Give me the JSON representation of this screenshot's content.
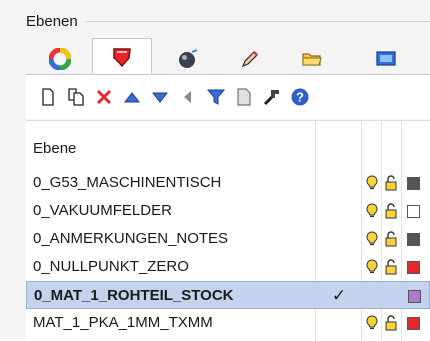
{
  "panel": {
    "title": "Ebenen"
  },
  "tabs": [
    {
      "icon": "color-wheel-icon",
      "active": false
    },
    {
      "icon": "layer-shield-icon",
      "active": true
    },
    {
      "icon": "material-sphere-icon",
      "active": false
    },
    {
      "icon": "pencil-icon",
      "active": false
    },
    {
      "icon": "folder-icon",
      "active": false
    },
    {
      "icon": "display-icon",
      "active": false
    }
  ],
  "toolbar": [
    "new-layer-icon",
    "copy-layer-icon",
    "delete-icon",
    "move-up-icon",
    "move-down-icon",
    "back-icon",
    "filter-icon",
    "properties-icon",
    "tools-icon",
    "help-icon"
  ],
  "list": {
    "header": "Ebene",
    "rows": [
      {
        "name": "0_G53_MASCHINENTISCH",
        "swatch": "#555555",
        "current": false,
        "selected": false
      },
      {
        "name": "0_VAKUUMFELDER",
        "swatch": "#ffffff",
        "current": false,
        "selected": false
      },
      {
        "name": "0_ANMERKUNGEN_NOTES",
        "swatch": "#555555",
        "current": false,
        "selected": false
      },
      {
        "name": "0_NULLPUNKT_ZERO",
        "swatch": "#e8262a",
        "current": false,
        "selected": false
      },
      {
        "name": "0_MAT_1_ROHTEIL_STOCK",
        "swatch": "#b07ac8",
        "current": true,
        "selected": true
      },
      {
        "name": "MAT_1_PKA_1MM_TXMM",
        "swatch": "#e8262a",
        "current": false,
        "selected": false
      }
    ]
  },
  "colors": {
    "accent_red": "#e8262a",
    "selection": "#c5d2ee"
  }
}
